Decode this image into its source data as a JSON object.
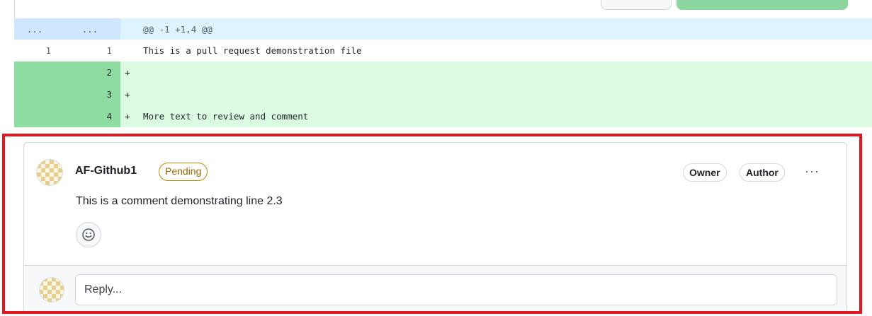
{
  "diff": {
    "hunk": {
      "left_marker": "...",
      "right_marker": "...",
      "header": "@@ -1 +1,4 @@"
    },
    "lines": [
      {
        "type": "context",
        "old": "1",
        "new": "1",
        "marker": "",
        "text": "This is a pull request demonstration file"
      },
      {
        "type": "add",
        "old": "",
        "new": "2",
        "marker": "+",
        "text": ""
      },
      {
        "type": "add",
        "old": "",
        "new": "3",
        "marker": "+",
        "text": ""
      },
      {
        "type": "add",
        "old": "",
        "new": "4",
        "marker": "+",
        "text": "More text to review and comment"
      }
    ]
  },
  "comment": {
    "author": "AF-Github1",
    "status_badge": "Pending",
    "roles": [
      "Owner",
      "Author"
    ],
    "more_icon": "···",
    "body": "This is a comment demonstrating line 2.3",
    "emoji_icon": "smiley-icon"
  },
  "reply": {
    "placeholder": "Reply..."
  },
  "colors": {
    "highlight_border": "#e3151e",
    "added_line_bg": "#dafbe1",
    "added_number_bg": "#8fdca2",
    "hunk_bg": "#ddf4ff",
    "pending": "#9a6700"
  }
}
